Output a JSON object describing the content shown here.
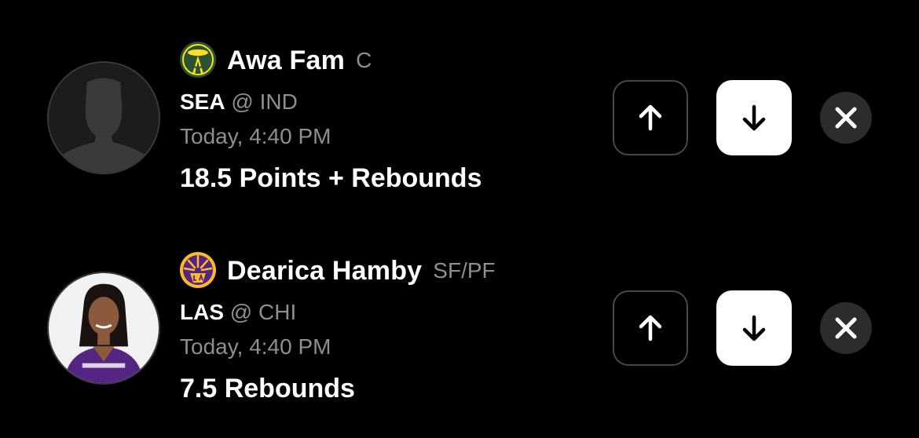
{
  "picks": [
    {
      "player_name": "Awa Fam",
      "position": "C",
      "team": "SEA",
      "at_symbol": "@",
      "opponent": "IND",
      "game_time": "Today, 4:40 PM",
      "prop": "18.5 Points + Rebounds",
      "team_logo_icon": "seattle-storm-logo-icon",
      "avatar_icon": "player-silhouette-icon",
      "logo_colors": {
        "primary": "#2c5234",
        "accent": "#fbe122"
      }
    },
    {
      "player_name": "Dearica Hamby",
      "position": "SF/PF",
      "team": "LAS",
      "at_symbol": "@",
      "opponent": "CHI",
      "game_time": "Today, 4:40 PM",
      "prop": "7.5 Rebounds",
      "team_logo_icon": "la-sparks-logo-icon",
      "avatar_icon": "player-photo-icon",
      "logo_colors": {
        "primary": "#552583",
        "accent": "#fdb927"
      }
    }
  ],
  "buttons": {
    "more_icon": "arrow-up-icon",
    "less_icon": "arrow-down-icon",
    "remove_icon": "close-icon"
  },
  "colors": {
    "background": "#000000",
    "secondary_text": "#8e8e93",
    "button_border": "#48484a",
    "remove_bg": "#2c2c2e"
  }
}
